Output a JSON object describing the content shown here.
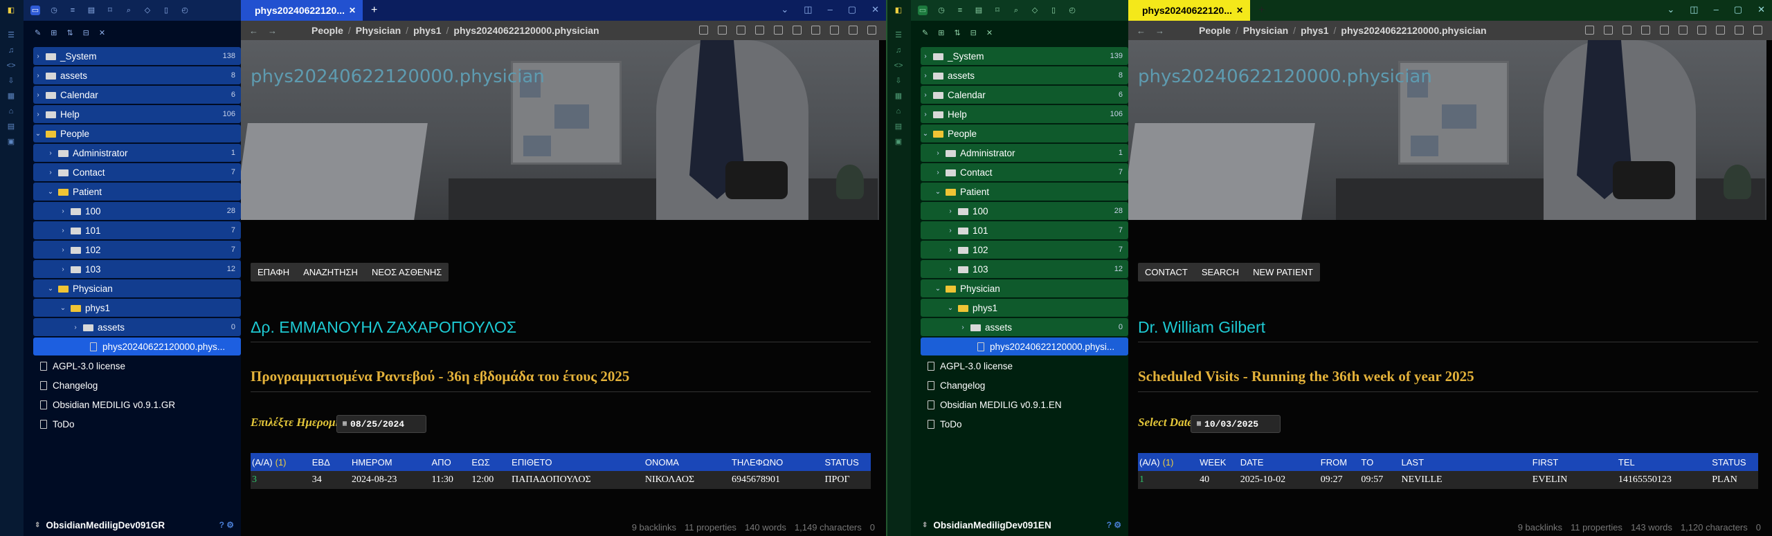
{
  "left": {
    "tab_title": "phys20240622120...",
    "breadcrumb": [
      "People",
      "Physician",
      "phys1",
      "phys20240622120000.physician"
    ],
    "tree": [
      {
        "label": "_System",
        "count": "138",
        "kind": "folder",
        "indent": 0,
        "chev": "›"
      },
      {
        "label": "assets",
        "count": "8",
        "kind": "folder",
        "indent": 0,
        "chev": "›"
      },
      {
        "label": "Calendar",
        "count": "6",
        "kind": "folder",
        "indent": 0,
        "chev": "›"
      },
      {
        "label": "Help",
        "count": "106",
        "kind": "folder",
        "indent": 0,
        "chev": "›"
      },
      {
        "label": "People",
        "count": "",
        "kind": "folder-open",
        "indent": 0,
        "chev": "⌄"
      },
      {
        "label": "Administrator",
        "count": "1",
        "kind": "folder",
        "indent": 1,
        "chev": "›"
      },
      {
        "label": "Contact",
        "count": "7",
        "kind": "folder",
        "indent": 1,
        "chev": "›"
      },
      {
        "label": "Patient",
        "count": "",
        "kind": "folder-open",
        "indent": 1,
        "chev": "⌄"
      },
      {
        "label": "100",
        "count": "28",
        "kind": "folder",
        "indent": 2,
        "chev": "›"
      },
      {
        "label": "101",
        "count": "7",
        "kind": "folder",
        "indent": 2,
        "chev": "›"
      },
      {
        "label": "102",
        "count": "7",
        "kind": "folder",
        "indent": 2,
        "chev": "›"
      },
      {
        "label": "103",
        "count": "12",
        "kind": "folder",
        "indent": 2,
        "chev": "›"
      },
      {
        "label": "Physician",
        "count": "",
        "kind": "folder-open",
        "indent": 1,
        "chev": "⌄"
      },
      {
        "label": "phys1",
        "count": "",
        "kind": "folder-open",
        "indent": 2,
        "chev": "⌄"
      },
      {
        "label": "assets",
        "count": "0",
        "kind": "folder",
        "indent": 3,
        "chev": "›"
      },
      {
        "label": "phys20240622120000.phys...",
        "count": "",
        "kind": "selected",
        "indent": 4,
        "chev": ""
      },
      {
        "label": "AGPL-3.0 license",
        "count": "",
        "kind": "file",
        "indent": 0,
        "chev": ""
      },
      {
        "label": "Changelog",
        "count": "",
        "kind": "file",
        "indent": 0,
        "chev": ""
      },
      {
        "label": "Obsidian MEDILIG v0.9.1.GR",
        "count": "",
        "kind": "file",
        "indent": 0,
        "chev": ""
      },
      {
        "label": "ToDo",
        "count": "",
        "kind": "file",
        "indent": 0,
        "chev": ""
      }
    ],
    "vault_name": "ObsidianMediligDev091GR",
    "banner_title": "phys20240622120000.physician",
    "buttons": [
      "ΕΠΑΦΗ",
      "ΑΝΑΖΗΤΗΣΗ",
      "ΝΕΟΣ ΑΣΘΕΝΗΣ"
    ],
    "doctor": "Δρ. ΕΜΜΑΝΟΥΗΛ ΖΑΧΑΡΟΠΟΥΛΟΣ",
    "schedule_heading": "Προγραμματισμένα Ραντεβού - 36η εβδομάδα του έτους 2025",
    "date_label": "Επιλέξτε Ημερομηνία:",
    "date_value": "08/25/2024",
    "table_headers": [
      "(Α/Α)",
      "ΕΒΔ",
      "ΗΜΕΡΟΜ",
      "ΑΠΟ",
      "ΕΩΣ",
      "ΕΠΙΘΕΤΟ",
      "ΟΝΟΜΑ",
      "ΤΗΛΕΦΩΝΟ",
      "STATUS"
    ],
    "header_count": "(1)",
    "table_rows": [
      [
        "3",
        "34",
        "2024-08-23",
        "11:30",
        "12:00",
        "ΠΑΠΑΔΟΠΟΥΛΟΣ",
        "ΝΙΚΟΛΑΟΣ",
        "6945678901",
        "ΠΡΟΓ"
      ]
    ],
    "status": [
      "9 backlinks",
      "11 properties",
      "140 words",
      "1,149 characters",
      "0"
    ]
  },
  "right": {
    "tab_title": "phys20240622120...",
    "breadcrumb": [
      "People",
      "Physician",
      "phys1",
      "phys20240622120000.physician"
    ],
    "tree": [
      {
        "label": "_System",
        "count": "139",
        "kind": "folder",
        "indent": 0,
        "chev": "›"
      },
      {
        "label": "assets",
        "count": "8",
        "kind": "folder",
        "indent": 0,
        "chev": "›"
      },
      {
        "label": "Calendar",
        "count": "6",
        "kind": "folder",
        "indent": 0,
        "chev": "›"
      },
      {
        "label": "Help",
        "count": "106",
        "kind": "folder",
        "indent": 0,
        "chev": "›"
      },
      {
        "label": "People",
        "count": "",
        "kind": "folder-open",
        "indent": 0,
        "chev": "⌄"
      },
      {
        "label": "Administrator",
        "count": "1",
        "kind": "folder",
        "indent": 1,
        "chev": "›"
      },
      {
        "label": "Contact",
        "count": "7",
        "kind": "folder",
        "indent": 1,
        "chev": "›"
      },
      {
        "label": "Patient",
        "count": "",
        "kind": "folder-open",
        "indent": 1,
        "chev": "⌄"
      },
      {
        "label": "100",
        "count": "28",
        "kind": "folder",
        "indent": 2,
        "chev": "›"
      },
      {
        "label": "101",
        "count": "7",
        "kind": "folder",
        "indent": 2,
        "chev": "›"
      },
      {
        "label": "102",
        "count": "7",
        "kind": "folder",
        "indent": 2,
        "chev": "›"
      },
      {
        "label": "103",
        "count": "12",
        "kind": "folder",
        "indent": 2,
        "chev": "›"
      },
      {
        "label": "Physician",
        "count": "",
        "kind": "folder-open",
        "indent": 1,
        "chev": "⌄"
      },
      {
        "label": "phys1",
        "count": "",
        "kind": "folder-open",
        "indent": 2,
        "chev": "⌄"
      },
      {
        "label": "assets",
        "count": "0",
        "kind": "folder",
        "indent": 3,
        "chev": "›"
      },
      {
        "label": "phys20240622120000.physi...",
        "count": "",
        "kind": "selected",
        "indent": 4,
        "chev": ""
      },
      {
        "label": "AGPL-3.0 license",
        "count": "",
        "kind": "file",
        "indent": 0,
        "chev": ""
      },
      {
        "label": "Changelog",
        "count": "",
        "kind": "file",
        "indent": 0,
        "chev": ""
      },
      {
        "label": "Obsidian MEDILIG v0.9.1.EN",
        "count": "",
        "kind": "file",
        "indent": 0,
        "chev": ""
      },
      {
        "label": "ToDo",
        "count": "",
        "kind": "file",
        "indent": 0,
        "chev": ""
      }
    ],
    "vault_name": "ObsidianMediligDev091EN",
    "banner_title": "phys20240622120000.physician",
    "buttons": [
      "CONTACT",
      "SEARCH",
      "NEW PATIENT"
    ],
    "doctor": "Dr. William Gilbert",
    "schedule_heading": "Scheduled Visits - Running the 36th week of year 2025",
    "date_label": "Select Date:",
    "date_value": "10/03/2025",
    "table_headers": [
      "(A/A)",
      "WEEK",
      "DATE",
      "FROM",
      "TO",
      "LAST",
      "FIRST",
      "TEL",
      "STATUS"
    ],
    "header_count": "(1)",
    "table_rows": [
      [
        "1",
        "40",
        "2025-10-02",
        "09:27",
        "09:57",
        "NEVILLE",
        "EVELIN",
        "14165550123",
        "PLAN"
      ]
    ],
    "status": [
      "9 backlinks",
      "11 properties",
      "143 words",
      "1,120 characters",
      "0"
    ]
  },
  "icons": {
    "ribbon": [
      "logo-icon",
      "layout-icon",
      "microphone-icon",
      "code-icon",
      "download-icon",
      "calendar-icon",
      "home-icon",
      "dashboard-icon",
      "inbox-icon"
    ]
  }
}
